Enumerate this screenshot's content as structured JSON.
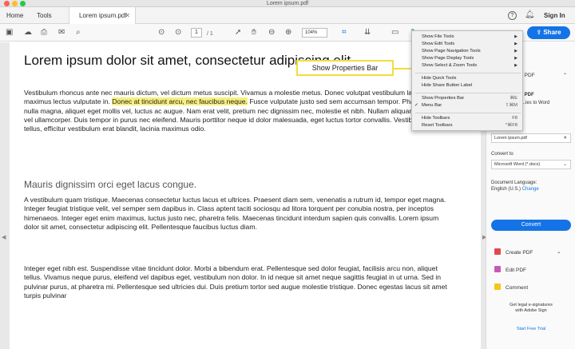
{
  "window": {
    "title": "Lorem ipsum.pdf"
  },
  "tabs": {
    "home": "Home",
    "tools": "Tools",
    "active_tab": "Lorem ipsum.pdf"
  },
  "header": {
    "help": "?",
    "sign_in": "Sign In"
  },
  "toolbar": {
    "page_number": "1",
    "page_total": "/ 1",
    "zoom": "104%",
    "share_label": "Share"
  },
  "document": {
    "heading": "Lorem ipsum dolor sit amet, consectetur adipiscing elit.",
    "p1_a": "Vestibulum rhoncus ante nec mauris dictum, vel dictum metus suscipit. Vivamus a molestie metus. Donec volutpat vestibulum lacus, blandit maximus lectus vulputate in. ",
    "p1_highlight": "Donec at tincidunt arcu, nec faucibus neque.",
    "p1_b": " Fusce vulputate justo sed sem accumsan tempor. Phasellus nulla magna, aliquet eget mollis vel, luctus ac augue. Nam erat velit, pretium nec dignissim nec, molestie et nibh. Nullam aliquam ac lorem vel ullamcorper. Duis tempor in purus nec eleifend. Mauris porttitor neque id dolor malesuada, eget luctus tortor convallis. Vestibulum arcu tellus, efficitur vestibulum erat blandit, lacinia maximus odio.",
    "subheading": "Mauris dignissim orci eget lacus congue.",
    "p2": "A vestibulum quam tristique. Maecenas consectetur luctus lacus et ultrices. Praesent diam sem, venenatis a rutrum id, tempor eget magna. Integer feugiat tristique velit, vel semper sem dapibus in. Class aptent taciti sociosqu ad litora torquent per conubia nostra, per inceptos himenaeos. Integer eget enim maximus, luctus justo nec, pharetra felis. Maecenas tincidunt interdum sapien quis convallis. Lorem ipsum dolor sit amet, consectetur adipiscing elit. Pellentesque faucibus luctus diam.",
    "p3": "Integer eget nibh est. Suspendisse vitae tincidunt dolor. Morbi a bibendum erat. Pellentesque sed dolor feugiat, facilisis arcu non, aliquet tellus. Vivamus neque purus, eleifend vel dapibus eget, vestibulum non dolor. In id neque sit amet neque sagittis feugiat in ut urna. Sed in pulvinar purus, at pharetra mi. Pellentesque sed ultricies dui. Duis pretium tortor sed augue molestie tristique. Donec egestas lacus sit amet turpis pulvinar"
  },
  "callout": {
    "label": "Show Properties Bar"
  },
  "menu": {
    "items": [
      {
        "label": "Show File Tools",
        "arrow": "▶"
      },
      {
        "label": "Show Edit Tools",
        "arrow": "▶"
      },
      {
        "label": "Show Page Navigation Tools",
        "arrow": "▶"
      },
      {
        "label": "Show Page Display Tools",
        "arrow": "▶"
      },
      {
        "label": "Show Select & Zoom Tools",
        "arrow": "▶"
      },
      {
        "label": "Hide Quick Tools"
      },
      {
        "label": "Hide Share Button Label"
      },
      {
        "label": "Show Properties Bar",
        "shortcut": "⌘E"
      },
      {
        "label": "Menu Bar",
        "shortcut": "⇧⌘M",
        "check": "✓"
      },
      {
        "label": "Hide Toolbars",
        "shortcut": "F8"
      },
      {
        "label": "Reset Toolbars",
        "shortcut": "^⌘F8"
      }
    ]
  },
  "right_pane": {
    "pdf_label": "t PDF",
    "to_word": "...ies to Word",
    "file_name": "Lorem ipsum.pdf",
    "convert_to_label": "Convert to",
    "convert_format": "Microsoft Word (*.docx)",
    "doc_language_label": "Document Language:",
    "doc_language_value": "English (U.S.)",
    "change": "Change",
    "convert_button": "Convert",
    "tools": [
      "Create PDF",
      "Edit PDF",
      "Comment"
    ],
    "promo_line1": "Get legal e-signatures",
    "promo_line2": "with Adobe Sign",
    "free_trial": "Start Free Trial"
  },
  "colors": {
    "accent": "#1473e6",
    "highlight": "#f6f080",
    "callout_border": "#f2dd3c",
    "create_pdf_icon": "#e34850",
    "edit_pdf_icon": "#c55ab8",
    "comment_icon": "#f5c518"
  }
}
